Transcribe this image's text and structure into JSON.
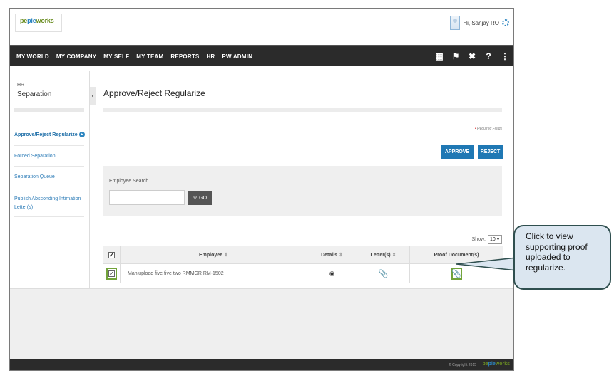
{
  "header": {
    "logo_text_a": "pe",
    "logo_text_b": "ple",
    "logo_text_c": "works",
    "greeting": "Hi, Sanjay RO"
  },
  "nav": {
    "items": [
      "MY WORLD",
      "MY COMPANY",
      "MY SELF",
      "MY TEAM",
      "REPORTS",
      "HR",
      "PW ADMIN"
    ],
    "icons": [
      "book-icon",
      "flag-icon",
      "tools-icon",
      "help-icon",
      "share-icon"
    ]
  },
  "sidebar": {
    "section": "HR",
    "title": "Separation",
    "items": [
      {
        "label": "Approve/Reject Regularize",
        "active": true
      },
      {
        "label": "Forced Separation",
        "active": false
      },
      {
        "label": "Separation Queue",
        "active": false
      },
      {
        "label": "Publish Absconding Intimation Letter(s)",
        "active": false
      }
    ]
  },
  "main": {
    "title": "Approve/Reject Regularize",
    "required_note": "Required Fields",
    "approve_label": "APPROVE",
    "reject_label": "REJECT",
    "search": {
      "label": "Employee Search",
      "value": "",
      "go_label": "GO"
    },
    "show_label": "Show:",
    "show_value": "10",
    "table": {
      "headers": [
        "Employee",
        "Details",
        "Letter(s)",
        "Proof Document(s)"
      ],
      "rows": [
        {
          "employee": "Manlupload five five two RMMGR RM-1502",
          "checked": true
        }
      ]
    }
  },
  "footer": {
    "copyright": "© Copyright 2015"
  },
  "callout": {
    "text": "Click to view supporting proof uploaded to regularize."
  },
  "colors": {
    "accent": "#1f78b4",
    "nav_bg": "#2b2b2b",
    "highlight": "#72a33a",
    "callout_bg": "#dbe6f0"
  }
}
